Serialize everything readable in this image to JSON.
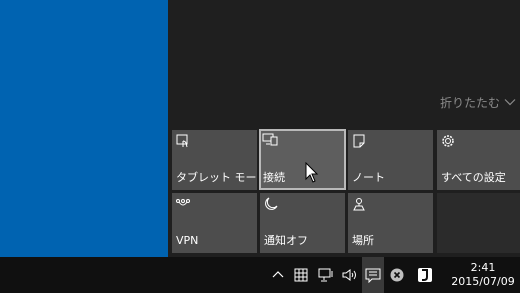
{
  "action_center": {
    "collapse_label": "折りたたむ",
    "tiles": [
      {
        "label": "タブレット モード",
        "icon": "tablet-mode-icon"
      },
      {
        "label": "接続",
        "icon": "connect-icon"
      },
      {
        "label": "ノート",
        "icon": "note-icon"
      },
      {
        "label": "すべての設定",
        "icon": "settings-gear-icon"
      },
      {
        "label": "VPN",
        "icon": "vpn-icon"
      },
      {
        "label": "通知オフ",
        "icon": "quiet-hours-moon-icon"
      },
      {
        "label": "場所",
        "icon": "location-icon"
      }
    ]
  },
  "taskbar": {
    "tray_icons": [
      "chevron-up-icon",
      "keyboard-icon",
      "network-icon",
      "volume-icon",
      "action-center-icon",
      "close-circle-icon",
      "app-icon"
    ],
    "time": "2:41",
    "date": "2015/07/09"
  },
  "colors": {
    "desktop": "#0063b1",
    "panel": "#1f1f1f",
    "tile": "#4d4d4d",
    "taskbar": "#101010"
  }
}
